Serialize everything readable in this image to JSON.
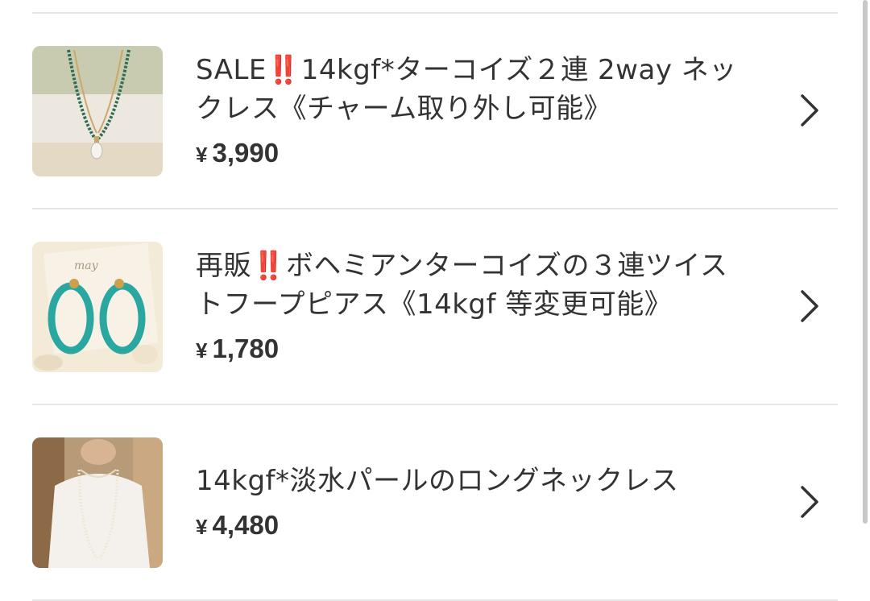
{
  "items": [
    {
      "title_prefix": "SALE",
      "title_bang": "‼️",
      "title_rest_line1": "14kgf*ターコイズ２連 2way ネッ",
      "title_line2": "クレス《チャーム取り外し可能》",
      "yen": "¥",
      "price": "3,990",
      "image_icon": "turquoise-necklace-photo"
    },
    {
      "title_prefix": "再販",
      "title_bang": "‼️",
      "title_rest_line1": "ボヘミアンターコイズの３連ツイス",
      "title_line2": "トフープピアス《14kgf 等変更可能》",
      "yen": "¥",
      "price": "1,780",
      "image_icon": "turquoise-earrings-photo",
      "card_text": "may"
    },
    {
      "title_line1": "14kgf*淡水パールのロングネックレス",
      "yen": "¥",
      "price": "4,480",
      "image_icon": "pearl-necklace-photo"
    }
  ],
  "colors": {
    "text": "#333333",
    "bang": "#e02020",
    "divider": "#e6e6e6"
  }
}
